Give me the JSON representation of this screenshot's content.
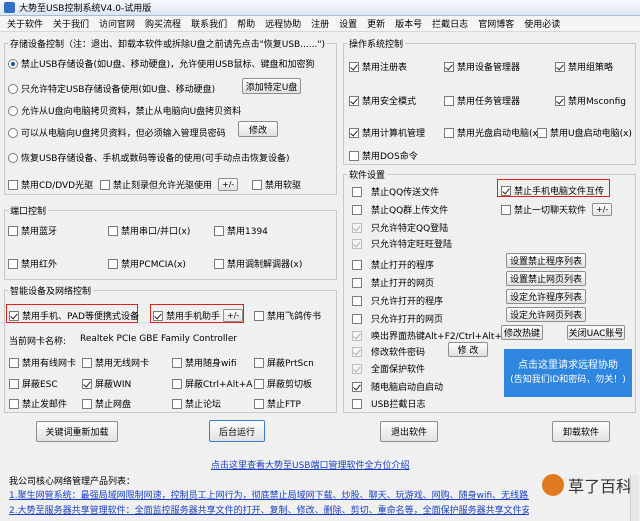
{
  "window": {
    "title": "大势至USB控制系统V4.0-试用版"
  },
  "menu": [
    "关于软件",
    "关于我们",
    "访问官网",
    "购买流程",
    "联系我们",
    "帮助",
    "远程协助",
    "注册",
    "设置",
    "更新",
    "版本号",
    "拦截日志",
    "官网博客",
    "使用必读"
  ],
  "storage": {
    "title": "存储设备控制（注：退出、卸载本软件或拆除U盘之前请先点击\"恢复USB......\")",
    "r1": "禁止USB存储设备(如U盘、移动硬盘)，允许使用USB鼠标、键盘和加密狗",
    "r2": "只允许特定USB存储设备使用(如U盘、移动硬盘)",
    "r2_btn": "添加特定U盘",
    "r3": "允许从U盘向电脑拷贝资料，禁止从电脑向U盘拷贝资料",
    "r4": "可以从电脑向U盘拷贝资料，但必须输入管理员密码",
    "r4_btn": "修改",
    "r5": "恢复USB存储设备、手机或数码等设备的使用(可手动点击恢复设备)",
    "cd1": "禁用CD/DVD光驱",
    "cd2": "禁止刻录但允许光驱使用",
    "cd3": "禁用软驱",
    "pm": "+/-"
  },
  "port": {
    "title": "端口控制",
    "items": [
      [
        "禁用蓝牙",
        "禁用串口/并口(x)",
        "禁用1394"
      ],
      [
        "禁用红外",
        "禁用PCMCIA(x)",
        "禁用调制解调器(x)"
      ]
    ]
  },
  "smart": {
    "title": "智能设备及网络控制",
    "phone_pad": "禁用手机、PAD等便携式设备",
    "phone_assist": "禁用手机助手",
    "pm": "+/-",
    "feige": "禁用飞鸽传书",
    "nic_label": "当前网卡名称:",
    "nic_value": "Realtek PCIe GBE Family Controller",
    "rows": [
      [
        "禁用有线网卡",
        "禁用无线网卡",
        "禁用随身wifi",
        "屏蔽PrtScn"
      ],
      [
        "屏蔽ESC",
        "屏蔽WIN",
        "屏蔽Ctrl+Alt+A",
        "屏蔽剪切板"
      ],
      [
        "禁止发邮件",
        "禁止网盘",
        "禁止论坛",
        "禁止FTP"
      ]
    ]
  },
  "os": {
    "title": "操作系统控制",
    "rows": [
      [
        "禁用注册表",
        "禁用设备管理器",
        "禁用组策略"
      ],
      [
        "禁用安全模式",
        "禁用任务管理器",
        "禁用Msconfig"
      ],
      [
        "禁用计算机管理",
        "禁用光盘启动电脑(x)",
        "禁用U盘启动电脑(x)"
      ],
      [
        "禁用DOS命令"
      ]
    ]
  },
  "soft": {
    "title": "软件设置",
    "qq1": "禁止QQ传送文件",
    "qq1_right": "禁止手机电脑文件互传",
    "qq2": "禁止QQ群上传文件",
    "qq2_right": "禁止一切聊天软件",
    "pm": "+/-",
    "qq3": "只允许特定QQ登陆",
    "qq4": "只允许特定旺旺登陆",
    "p1": "禁止打开的程序",
    "p1_btn": "设置禁止程序列表",
    "p2": "禁止打开的网页",
    "p2_btn": "设置禁止网页列表",
    "p3": "只允许打开的程序",
    "p3_btn": "设定允许程序列表",
    "p4": "只允许打开的网页",
    "p4_btn": "设定允许网页列表",
    "hotkey": "唤出界面热键Alt+F2/Ctrl+Alt+2",
    "hotkey_btn": "修改热键",
    "uac_btn": "关闭UAC账号",
    "pwd": "修改软件密码",
    "pwd_btn": "修 改",
    "protect": "全面保护软件",
    "autostart": "随电脑启动自启动",
    "usblog": "USB拦截日志",
    "remote_main": "点击这里请求远程协助",
    "remote_sub": "(告知我们ID和密码，勿关！)"
  },
  "bottom": {
    "b1": "关键词重新加载",
    "b2": "后台运行",
    "b3": "退出软件",
    "b4": "卸载软件",
    "guide_link": "点击这里查看大势至USB端口管理软件全方位介绍",
    "products_title": "我公司核心网络管理产品列表：",
    "p1": "1.聚生网管系统：最强局域网限制网速，控制员工上网行为，彻底禁止局域网下载、炒股、聊天、玩游戏、网购、随身wifi、无线路由...",
    "p2": "2.大势至服务器共享管理软件：全面监控服务器共享文件的打开、复制、修改、删除、剪切、重命名等，全面保护服务器共享文件安全..."
  },
  "watermark": "草了百科"
}
